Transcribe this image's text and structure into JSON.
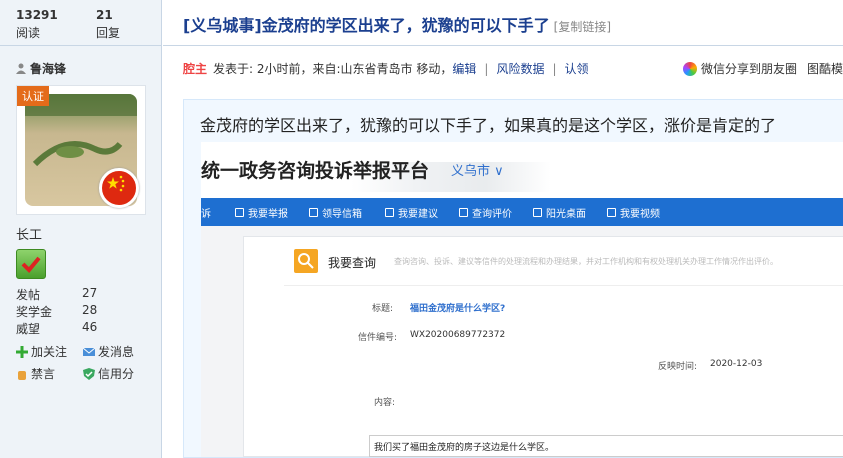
{
  "stats": {
    "views_num": "13291",
    "views_label": "阅读",
    "replies_num": "21",
    "replies_label": "回复"
  },
  "author": {
    "name": "鲁海锋",
    "badge": "认证",
    "rank": "长工",
    "fields": [
      {
        "label": "发帖",
        "value": "27"
      },
      {
        "label": "奖学金",
        "value": "28"
      },
      {
        "label": "威望",
        "value": "46"
      }
    ],
    "actions": {
      "follow": "加关注",
      "message": "发消息",
      "ban": "禁言",
      "credit": "信用分"
    }
  },
  "post": {
    "title": "[义乌城事]金茂府的学区出来了，犹豫的可以下手了",
    "copy_link": "[复制链接]",
    "op_tag": "腔主",
    "meta_text": "发表于: 2小时前，来自:山东省青岛市 移动，",
    "edit": "编辑",
    "risk": "风险数据",
    "claim": "认领",
    "share": "微信分享到朋友圈",
    "share2": "图酷模",
    "body": "金茂府的学区出来了，犹豫的可以下手了，如果真的是这个学区，涨价是肯定的了"
  },
  "embedded": {
    "portal_title": "统一政务咨询投诉举报平台",
    "city": "义乌市 ∨",
    "nav": [
      "诉",
      "我要举报",
      "领导信箱",
      "我要建议",
      "查询评价",
      "阳光桌面",
      "我要视频"
    ],
    "query_title": "我要查询",
    "query_desc": "查询咨询、投诉、建议等信件的处理流程和办理结果，并对工作机构和有权处理机关办理工作情况作出评价。",
    "fields": {
      "subject_label": "标题:",
      "subject_value": "福田金茂府是什么学区?",
      "id_label": "信件编号:",
      "id_value": "WX20200689772372",
      "date_label": "反映时间:",
      "date_value": "2020-12-03",
      "content_label": "内容:",
      "content_value": "我们买了福田金茂府的房子这边是什么学区。"
    }
  }
}
